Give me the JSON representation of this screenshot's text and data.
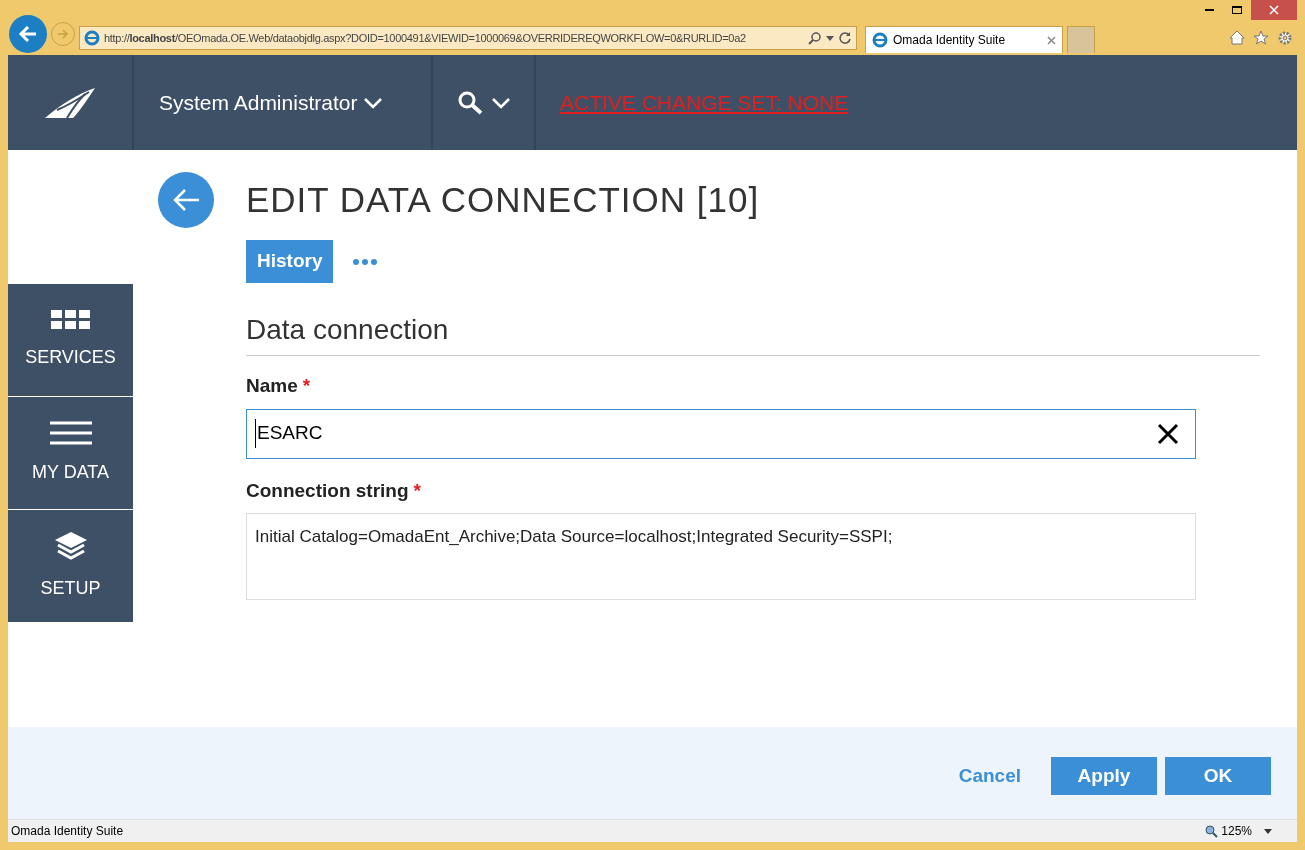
{
  "browser": {
    "address": "http://**localhost**/OEOmada.OE.Web/dataobjdlg.aspx?DOID=1000491&VIEWID=1000069&OVERRIDEREQWORKFLOW=0&RURLID=0a2",
    "tab_title": "Omada Identity Suite"
  },
  "header": {
    "user": "System Administrator",
    "change_set": "ACTIVE CHANGE SET: NONE"
  },
  "sidebar": {
    "items": [
      {
        "kind": "grid",
        "label": "SERVICES"
      },
      {
        "kind": "lines",
        "label": "MY DATA"
      },
      {
        "kind": "layers",
        "label": "SETUP"
      }
    ]
  },
  "page": {
    "title": "EDIT DATA CONNECTION [10]",
    "actions": [
      {
        "label": "History"
      }
    ],
    "section": "Data connection",
    "fields": [
      {
        "kind": "text",
        "label": "Name",
        "required_mark": "*",
        "value": "ESARC"
      },
      {
        "kind": "textarea",
        "label": "Connection string",
        "required_mark": "*",
        "value": "Initial Catalog=OmadaEnt_Archive;Data Source=localhost;Integrated Security=SSPI;"
      }
    ]
  },
  "footer": {
    "buttons": [
      {
        "kind": "link",
        "label": "Cancel"
      },
      {
        "kind": "primary",
        "label": "Apply"
      },
      {
        "kind": "primary",
        "label": "OK"
      }
    ]
  },
  "status_bar": {
    "text": "Omada Identity Suite",
    "zoom": "125%"
  }
}
